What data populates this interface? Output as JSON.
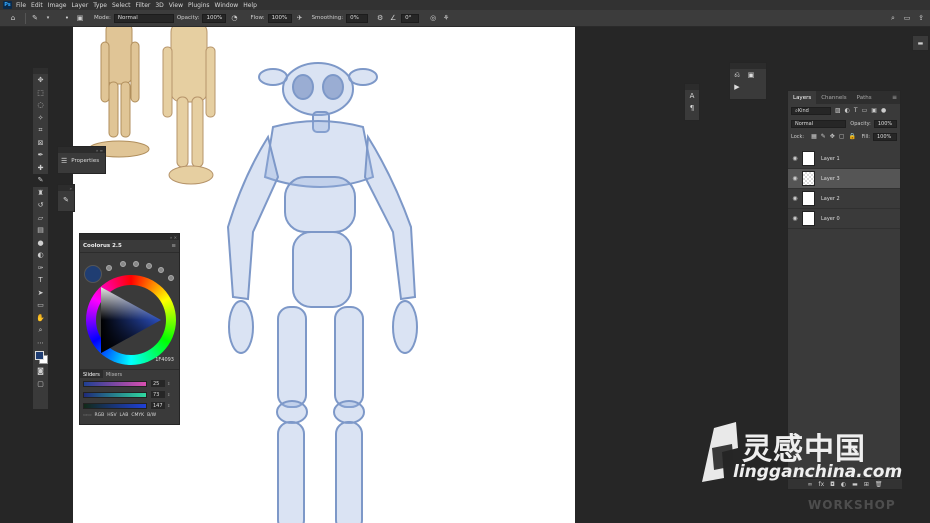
{
  "menubar": {
    "logo": "Ps",
    "items": [
      "File",
      "Edit",
      "Image",
      "Layer",
      "Type",
      "Select",
      "Filter",
      "3D",
      "View",
      "Plugins",
      "Window",
      "Help"
    ]
  },
  "options": {
    "mode_label": "Mode:",
    "mode_value": "Normal",
    "opacity_label": "Opacity:",
    "opacity_value": "100%",
    "flow_label": "Flow:",
    "flow_value": "100%",
    "smoothing_label": "Smoothing:",
    "smoothing_value": "0%",
    "angle_value": "0°"
  },
  "properties_panel": {
    "label": "Properties"
  },
  "coolorus": {
    "title": "Coolorus 2.5",
    "hex": "1F4093",
    "tabs": [
      "Sliders",
      "Mixers"
    ],
    "sliders": [
      {
        "value": "25",
        "gradient": "linear-gradient(90deg,#1f4093,#d94fb0)"
      },
      {
        "value": "73",
        "gradient": "linear-gradient(90deg,#1f2a7a,#2fd9a0)"
      },
      {
        "value": "147",
        "gradient": "linear-gradient(90deg,#122a18,#1f40d9)"
      }
    ],
    "modes": [
      "RGB",
      "HSV",
      "LAB",
      "CMYK",
      "B/W"
    ],
    "fg_color": "#1f3d72"
  },
  "layers": {
    "tabs": [
      "Layers",
      "Channels",
      "Paths"
    ],
    "filter_kind": "Kind",
    "blend_mode": "Normal",
    "opacity_label": "Opacity:",
    "opacity_value": "100%",
    "lock_label": "Lock:",
    "fill_label": "Fill:",
    "fill_value": "100%",
    "items": [
      {
        "name": "Layer 1",
        "selected": false,
        "thumb": "white"
      },
      {
        "name": "Layer 3",
        "selected": true,
        "thumb": "checker"
      },
      {
        "name": "Layer 2",
        "selected": false,
        "thumb": "white"
      },
      {
        "name": "Layer 0",
        "selected": false,
        "thumb": "white"
      }
    ]
  },
  "watermark": {
    "title": "灵感中国",
    "subtitle": "lingganchina.com",
    "workshop": "WORKSHOP"
  },
  "colors": {
    "ui_dark": "#262626",
    "panel": "#3a3a3a",
    "accent_blue": "#1f3d72",
    "sketch_blue": "#6f8fc2"
  }
}
